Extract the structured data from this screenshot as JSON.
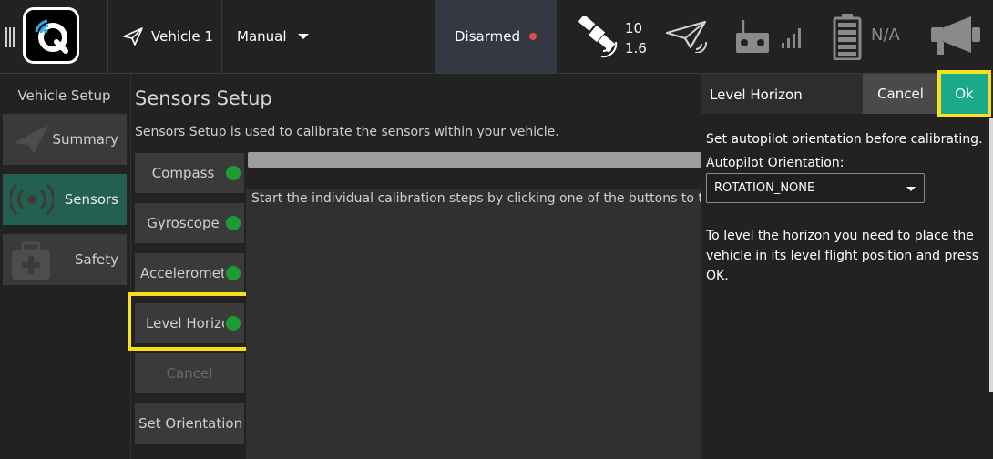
{
  "toolbar": {
    "vehicle_label": "Vehicle 1",
    "flight_mode": "Manual",
    "arm_status": "Disarmed",
    "gps_sat_count": "10",
    "gps_hdop": "1.6",
    "battery_text": "N/A",
    "icons": [
      "menu-icon",
      "qgc-logo-icon",
      "paper-plane-icon",
      "chevron-down-icon",
      "satellite-icon",
      "telemetry-plane-icon",
      "rc-transmitter-icon",
      "signal-bars-icon",
      "battery-icon",
      "megaphone-icon"
    ],
    "colors": {
      "armed_dot": "#e34a4a",
      "arm_bg": "#333842"
    }
  },
  "setup_nav": {
    "title": "Vehicle Setup",
    "items": [
      {
        "label": "Summary",
        "icon": "plane-icon",
        "active": false
      },
      {
        "label": "Sensors",
        "icon": "radio-waves-icon",
        "active": true
      },
      {
        "label": "Safety",
        "icon": "first-aid-kit-icon",
        "active": false
      }
    ],
    "active_color": "#24604f"
  },
  "sensors": {
    "title": "Sensors Setup",
    "description": "Sensors Setup is used to calibrate the sensors within your vehicle.",
    "buttons": [
      {
        "label": "Compass",
        "status": "ok"
      },
      {
        "label": "Gyroscope",
        "status": "ok"
      },
      {
        "label": "Accelerometer",
        "status": "ok"
      },
      {
        "label": "Level Horizon",
        "status": "ok"
      },
      {
        "label": "Cancel",
        "status": "disabled"
      },
      {
        "label": "Set Orientations",
        "status": "none"
      }
    ],
    "status_text": "Start the individual calibration steps by clicking one of the buttons to the left.",
    "status_ok_color": "#1b9c33"
  },
  "dialog": {
    "title": "Level Horizon",
    "cancel_label": "Cancel",
    "ok_label": "Ok",
    "line1": "Set autopilot orientation before calibrating.",
    "orientation_label": "Autopilot Orientation:",
    "orientation_value": "ROTATION_NONE",
    "instructions": "To level the horizon you need to place the vehicle in its level flight position and press OK.",
    "ok_color": "#1aa98b",
    "highlight_color": "#f7e01e"
  }
}
